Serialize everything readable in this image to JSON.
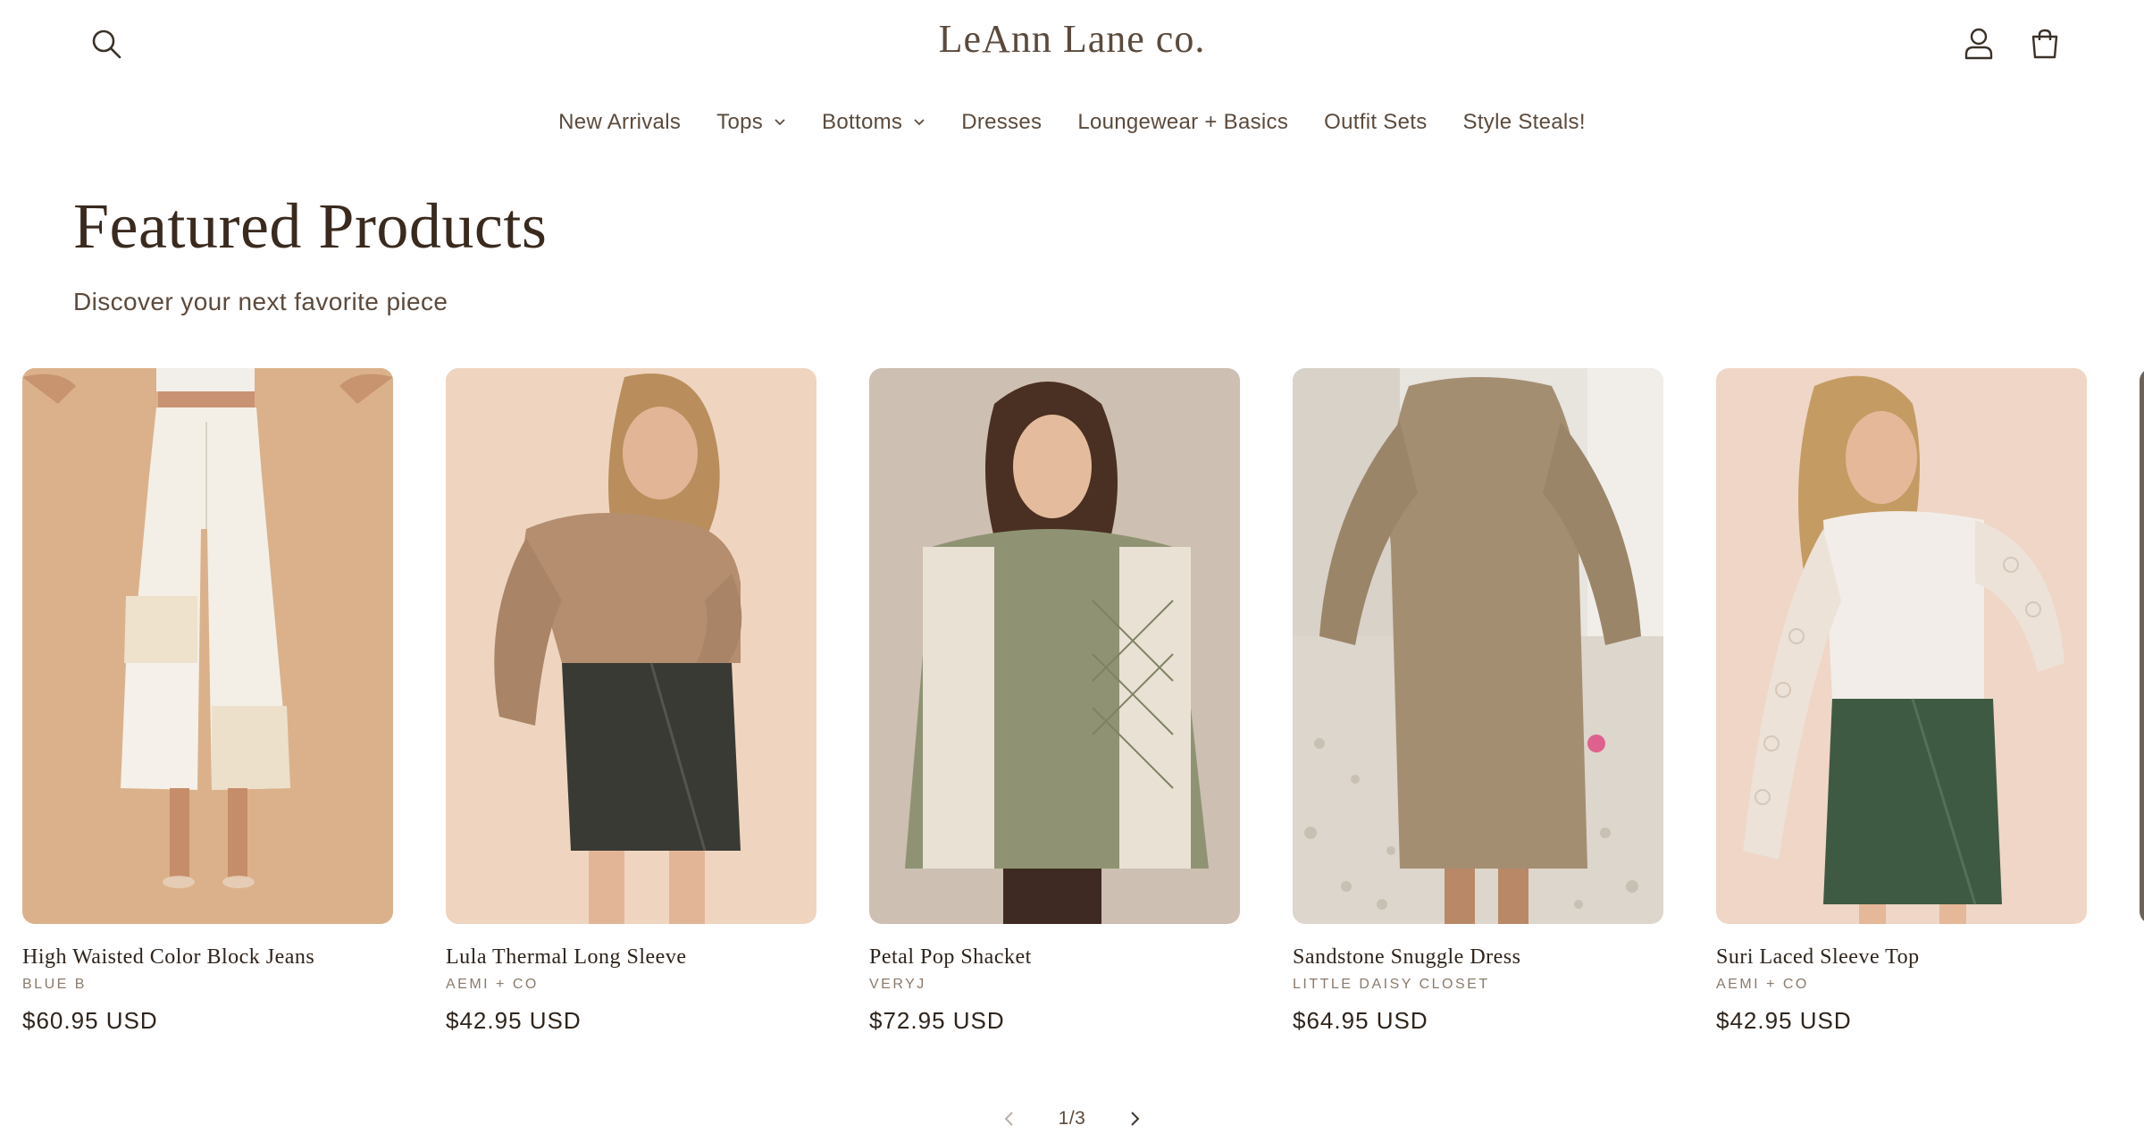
{
  "header": {
    "logo": "LeAnn Lane co.",
    "icons": {
      "search": "search-icon",
      "account": "account-icon",
      "cart": "cart-icon"
    }
  },
  "nav": {
    "items": [
      {
        "label": "New Arrivals",
        "has_dropdown": false
      },
      {
        "label": "Tops",
        "has_dropdown": true
      },
      {
        "label": "Bottoms",
        "has_dropdown": true
      },
      {
        "label": "Dresses",
        "has_dropdown": false
      },
      {
        "label": "Loungewear + Basics",
        "has_dropdown": false
      },
      {
        "label": "Outfit Sets",
        "has_dropdown": false
      },
      {
        "label": "Style Steals!",
        "has_dropdown": false
      }
    ]
  },
  "section": {
    "title": "Featured Products",
    "subtitle": "Discover your next favorite piece"
  },
  "products": [
    {
      "title": "High Waisted Color Block Jeans",
      "vendor": "BLUE B",
      "price": "$60.95 USD"
    },
    {
      "title": "Lula Thermal Long Sleeve",
      "vendor": "AEMI + CO",
      "price": "$42.95 USD"
    },
    {
      "title": "Petal Pop Shacket",
      "vendor": "VERYJ",
      "price": "$72.95 USD"
    },
    {
      "title": "Sandstone Snuggle Dress",
      "vendor": "LITTLE DAISY CLOSET",
      "price": "$64.95 USD"
    },
    {
      "title": "Suri Laced Sleeve Top",
      "vendor": "AEMI + CO",
      "price": "$42.95 USD"
    }
  ],
  "slider": {
    "counter": "1/3",
    "prev_icon": "chevron-left-icon",
    "next_icon": "chevron-right-icon"
  },
  "colors": {
    "text_primary": "#2e241b",
    "text_secondary": "#5b4a3c",
    "vendor_text": "#8a7b6c",
    "background": "#ffffff"
  }
}
